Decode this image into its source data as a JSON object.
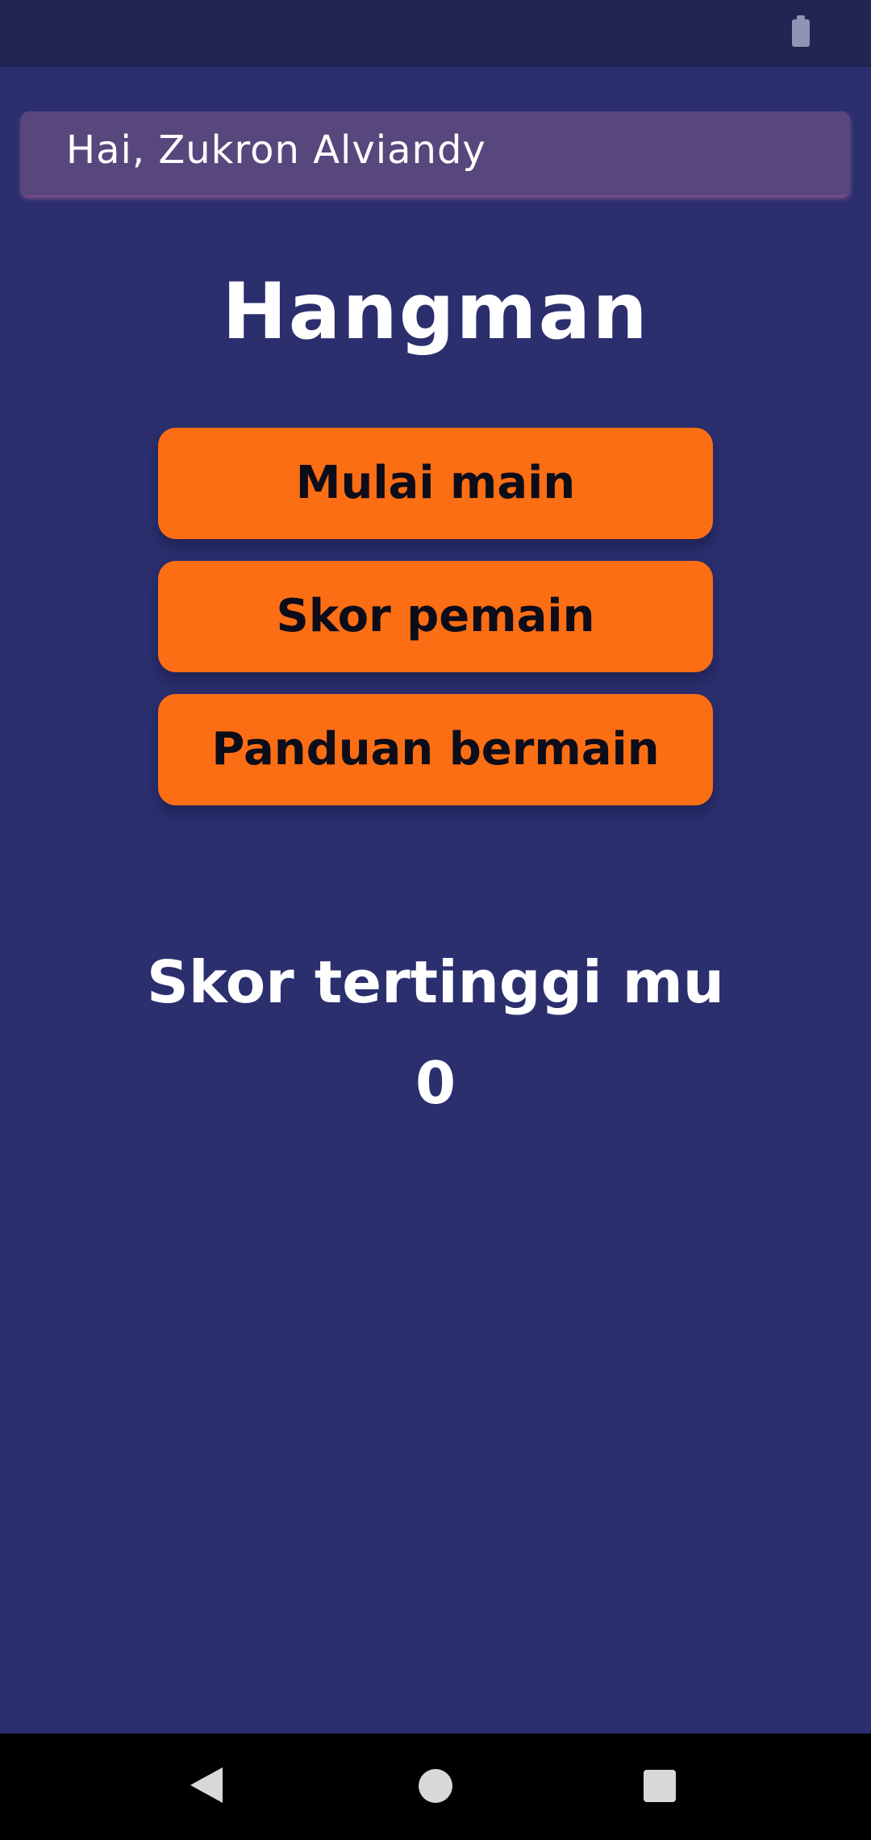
{
  "status_bar": {
    "battery_icon": "battery-icon"
  },
  "greeting": {
    "text": "Hai, Zukron Alviandy"
  },
  "app": {
    "title": "Hangman"
  },
  "menu": {
    "start_label": "Mulai main",
    "scores_label": "Skor pemain",
    "guide_label": "Panduan bermain"
  },
  "highscore": {
    "label": "Skor tertinggi mu",
    "value": "0"
  },
  "nav_bar": {
    "back_icon": "back-triangle-icon",
    "home_icon": "home-circle-icon",
    "recents_icon": "recents-square-icon"
  },
  "colors": {
    "background": "#2b2f6e",
    "status_bar": "#222452",
    "greeting_card": "#57477c",
    "button": "#fc6e14",
    "button_text": "#0d0d1a",
    "text": "#ffffff"
  }
}
